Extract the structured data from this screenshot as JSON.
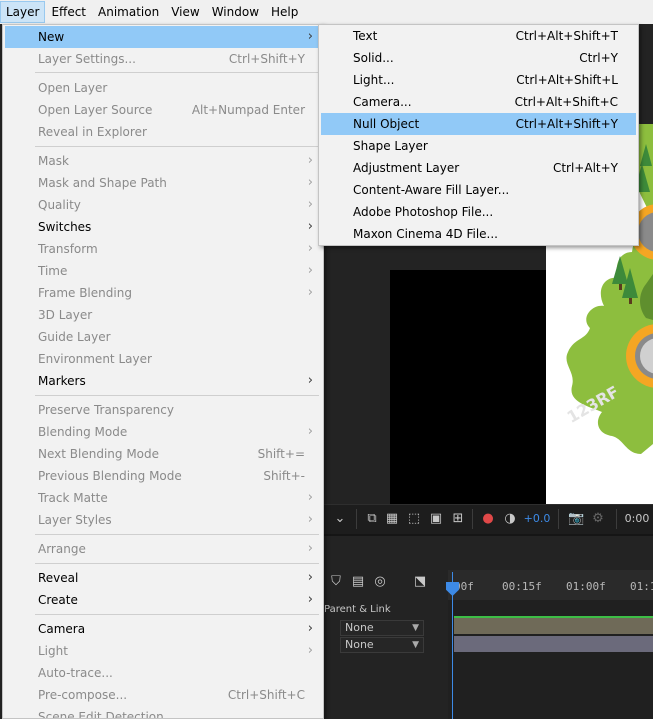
{
  "menubar": {
    "items": [
      {
        "label": "Layer",
        "active": true
      },
      {
        "label": "Effect"
      },
      {
        "label": "Animation"
      },
      {
        "label": "View"
      },
      {
        "label": "Window"
      },
      {
        "label": "Help"
      }
    ]
  },
  "layer_menu": {
    "items": [
      {
        "label": "New",
        "shortcut": "",
        "submenu": true,
        "enabled": true,
        "highlighted": true
      },
      {
        "label": "Layer Settings...",
        "shortcut": "Ctrl+Shift+Y",
        "enabled": false
      },
      {
        "label": "Open Layer",
        "enabled": false
      },
      {
        "label": "Open Layer Source",
        "shortcut": "Alt+Numpad Enter",
        "enabled": false
      },
      {
        "label": "Reveal in Explorer",
        "enabled": false
      },
      {
        "label": "Mask",
        "submenu": true,
        "enabled": false
      },
      {
        "label": "Mask and Shape Path",
        "submenu": true,
        "enabled": false
      },
      {
        "label": "Quality",
        "submenu": true,
        "enabled": false
      },
      {
        "label": "Switches",
        "submenu": true,
        "enabled": true
      },
      {
        "label": "Transform",
        "submenu": true,
        "enabled": false
      },
      {
        "label": "Time",
        "submenu": true,
        "enabled": false
      },
      {
        "label": "Frame Blending",
        "submenu": true,
        "enabled": false
      },
      {
        "label": "3D Layer",
        "enabled": false
      },
      {
        "label": "Guide Layer",
        "enabled": false
      },
      {
        "label": "Environment Layer",
        "enabled": false
      },
      {
        "label": "Markers",
        "submenu": true,
        "enabled": true
      },
      {
        "label": "Preserve Transparency",
        "enabled": false
      },
      {
        "label": "Blending Mode",
        "submenu": true,
        "enabled": false
      },
      {
        "label": "Next Blending Mode",
        "shortcut": "Shift+=",
        "enabled": false
      },
      {
        "label": "Previous Blending Mode",
        "shortcut": "Shift+-",
        "enabled": false
      },
      {
        "label": "Track Matte",
        "submenu": true,
        "enabled": false
      },
      {
        "label": "Layer Styles",
        "submenu": true,
        "enabled": false
      },
      {
        "label": "Arrange",
        "submenu": true,
        "enabled": false
      },
      {
        "label": "Reveal",
        "submenu": true,
        "enabled": true
      },
      {
        "label": "Create",
        "submenu": true,
        "enabled": true
      },
      {
        "label": "Camera",
        "submenu": true,
        "enabled": true
      },
      {
        "label": "Light",
        "submenu": true,
        "enabled": false
      },
      {
        "label": "Auto-trace...",
        "enabled": false
      },
      {
        "label": "Pre-compose...",
        "shortcut": "Ctrl+Shift+C",
        "enabled": false
      },
      {
        "label": "Scene Edit Detection",
        "enabled": false
      }
    ]
  },
  "new_submenu": {
    "items": [
      {
        "label": "Text",
        "shortcut": "Ctrl+Alt+Shift+T"
      },
      {
        "label": "Solid...",
        "shortcut": "Ctrl+Y"
      },
      {
        "label": "Light...",
        "shortcut": "Ctrl+Alt+Shift+L"
      },
      {
        "label": "Camera...",
        "shortcut": "Ctrl+Alt+Shift+C"
      },
      {
        "label": "Null Object",
        "shortcut": "Ctrl+Alt+Shift+Y",
        "highlighted": true
      },
      {
        "label": "Shape Layer",
        "shortcut": ""
      },
      {
        "label": "Adjustment Layer",
        "shortcut": "Ctrl+Alt+Y"
      },
      {
        "label": "Content-Aware Fill Layer...",
        "shortcut": ""
      },
      {
        "label": "Adobe Photoshop File...",
        "shortcut": ""
      },
      {
        "label": "Maxon Cinema 4D File...",
        "shortcut": ""
      }
    ]
  },
  "viewer": {
    "exposure_value": "+0.0",
    "timecode": "0:00",
    "watermark": "123RF"
  },
  "timeline": {
    "ruler_labels": [
      "00f",
      "00:15f",
      "01:00f",
      "01:1"
    ],
    "parent_header": "Parent & Link",
    "rows": [
      {
        "parent": "None"
      },
      {
        "parent": "None"
      }
    ]
  },
  "colors": {
    "menu_bg": "#f2f2f2",
    "highlight": "#91c9f7",
    "disabled_text": "#8a8a8a",
    "playhead": "#3d8ae6",
    "artwork_green": "#8dbe3e",
    "artwork_tree": "#3d8a3a",
    "artwork_orange": "#f5a623"
  }
}
